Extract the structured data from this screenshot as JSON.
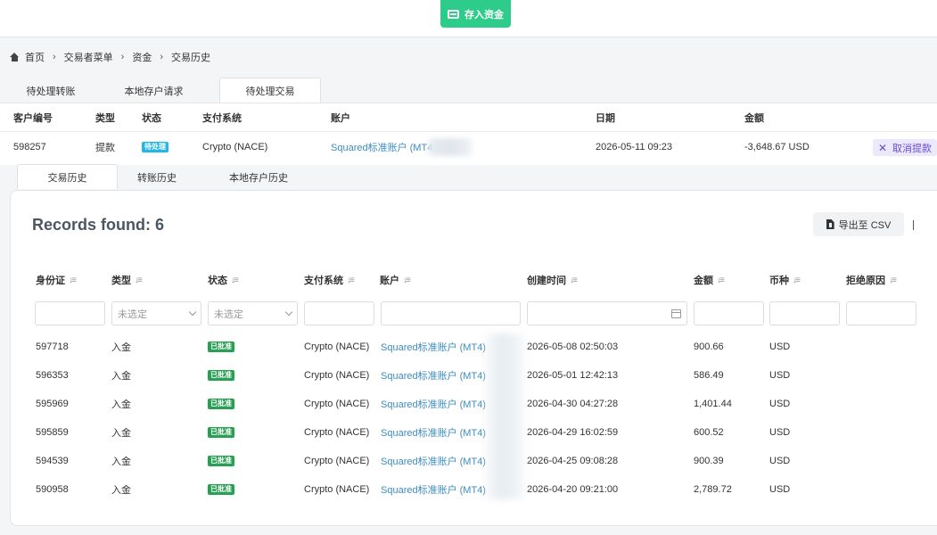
{
  "topbar": {
    "deposit_label": "存入资金"
  },
  "breadcrumb": [
    "首页",
    "交易者菜单",
    "资金",
    "交易历史"
  ],
  "top_tabs": [
    {
      "label": "待处理转账",
      "active": false
    },
    {
      "label": "本地存户请求",
      "active": false
    },
    {
      "label": "待处理交易",
      "active": true
    }
  ],
  "pending": {
    "headers": [
      "客户编号",
      "类型",
      "状态",
      "支付系统",
      "账户",
      "日期",
      "金额"
    ],
    "row": {
      "id": "598257",
      "type": "提款",
      "status": "待处理",
      "payment": "Crypto (NACE)",
      "account": "Squared标准账户 (MT4",
      "date": "2026-05-11 09:23",
      "amount": "-3,648.67 USD",
      "action": "取消提款"
    }
  },
  "history_tabs": [
    {
      "label": "交易历史",
      "active": true
    },
    {
      "label": "转账历史",
      "active": false
    },
    {
      "label": "本地存户历史",
      "active": false
    }
  ],
  "records": {
    "title": "Records found: 6",
    "export_label": "导出至 CSV",
    "columns": [
      "身份证",
      "类型",
      "状态",
      "支付系统",
      "账户",
      "创建时间",
      "金额",
      "币种",
      "拒绝原因"
    ],
    "filters": {
      "type_placeholder": "未选定",
      "status_placeholder": "未选定"
    },
    "rows": [
      {
        "id": "597718",
        "type": "入金",
        "status": "已批准",
        "payment": "Crypto (NACE)",
        "account": "Squared标准账户 (MT4)",
        "created": "2026-05-08 02:50:03",
        "amount": "900.66",
        "currency": "USD",
        "reason": ""
      },
      {
        "id": "596353",
        "type": "入金",
        "status": "已批准",
        "payment": "Crypto (NACE)",
        "account": "Squared标准账户 (MT4)",
        "created": "2026-05-01 12:42:13",
        "amount": "586.49",
        "currency": "USD",
        "reason": ""
      },
      {
        "id": "595969",
        "type": "入金",
        "status": "已批准",
        "payment": "Crypto (NACE)",
        "account": "Squared标准账户 (MT4)",
        "created": "2026-04-30 04:27:28",
        "amount": "1,401.44",
        "currency": "USD",
        "reason": ""
      },
      {
        "id": "595859",
        "type": "入金",
        "status": "已批准",
        "payment": "Crypto (NACE)",
        "account": "Squared标准账户 (MT4)",
        "created": "2026-04-29 16:02:59",
        "amount": "600.52",
        "currency": "USD",
        "reason": ""
      },
      {
        "id": "594539",
        "type": "入金",
        "status": "已批准",
        "payment": "Crypto (NACE)",
        "account": "Squared标准账户 (MT4)",
        "created": "2026-04-25 09:08:28",
        "amount": "900.39",
        "currency": "USD",
        "reason": ""
      },
      {
        "id": "590958",
        "type": "入金",
        "status": "已批准",
        "payment": "Crypto (NACE)",
        "account": "Squared标准账户 (MT4)",
        "created": "2026-04-20 09:21:00",
        "amount": "2,789.72",
        "currency": "USD",
        "reason": ""
      }
    ]
  },
  "colors": {
    "accent_green": "#2ecc8a",
    "link_blue": "#3c8dbc",
    "approved_green": "#27a052",
    "pending_cyan": "#23b7e5",
    "cancel_purple": "#6a4ad2"
  }
}
